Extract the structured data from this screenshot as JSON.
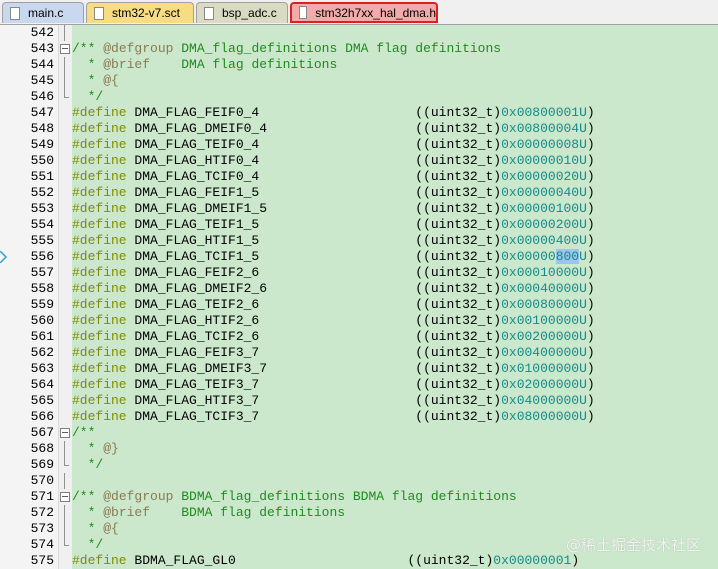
{
  "tabs": [
    {
      "label": "main.c",
      "color": "#c9d7ef",
      "active": false
    },
    {
      "label": "stm32-v7.sct",
      "color": "#f7dc82",
      "active": false
    },
    {
      "label": "bsp_adc.c",
      "color": "#d9dcc2",
      "active": false
    },
    {
      "label": "stm32h7xx_hal_dma.h",
      "color": "#f2aaaa",
      "active": true
    }
  ],
  "editor": {
    "current_line": 556,
    "highlight": {
      "line": 556,
      "text": "800"
    },
    "lines": [
      {
        "num": 542,
        "kind": "blank"
      },
      {
        "num": 543,
        "kind": "doc",
        "fold": true,
        "text": "/** @defgroup DMA_flag_definitions DMA flag definitions"
      },
      {
        "num": 544,
        "kind": "doc",
        "text": "  * @brief    DMA flag definitions"
      },
      {
        "num": 545,
        "kind": "doc",
        "text": "  * @{"
      },
      {
        "num": 546,
        "kind": "doc",
        "text": "  */"
      },
      {
        "num": 547,
        "kind": "define",
        "name": "DMA_FLAG_FEIF0_4",
        "cast": "((uint32_t)",
        "value": "0x00800001U",
        "close": ")"
      },
      {
        "num": 548,
        "kind": "define",
        "name": "DMA_FLAG_DMEIF0_4",
        "cast": "((uint32_t)",
        "value": "0x00800004U",
        "close": ")"
      },
      {
        "num": 549,
        "kind": "define",
        "name": "DMA_FLAG_TEIF0_4",
        "cast": "((uint32_t)",
        "value": "0x00000008U",
        "close": ")"
      },
      {
        "num": 550,
        "kind": "define",
        "name": "DMA_FLAG_HTIF0_4",
        "cast": "((uint32_t)",
        "value": "0x00000010U",
        "close": ")"
      },
      {
        "num": 551,
        "kind": "define",
        "name": "DMA_FLAG_TCIF0_4",
        "cast": "((uint32_t)",
        "value": "0x00000020U",
        "close": ")"
      },
      {
        "num": 552,
        "kind": "define",
        "name": "DMA_FLAG_FEIF1_5",
        "cast": "((uint32_t)",
        "value": "0x00000040U",
        "close": ")"
      },
      {
        "num": 553,
        "kind": "define",
        "name": "DMA_FLAG_DMEIF1_5",
        "cast": "((uint32_t)",
        "value": "0x00000100U",
        "close": ")"
      },
      {
        "num": 554,
        "kind": "define",
        "name": "DMA_FLAG_TEIF1_5",
        "cast": "((uint32_t)",
        "value": "0x00000200U",
        "close": ")"
      },
      {
        "num": 555,
        "kind": "define",
        "name": "DMA_FLAG_HTIF1_5",
        "cast": "((uint32_t)",
        "value": "0x00000400U",
        "close": ")"
      },
      {
        "num": 556,
        "kind": "define",
        "name": "DMA_FLAG_TCIF1_5",
        "cast": "((uint32_t)",
        "value": "0x00000800U",
        "close": ")"
      },
      {
        "num": 557,
        "kind": "define",
        "name": "DMA_FLAG_FEIF2_6",
        "cast": "((uint32_t)",
        "value": "0x00010000U",
        "close": ")"
      },
      {
        "num": 558,
        "kind": "define",
        "name": "DMA_FLAG_DMEIF2_6",
        "cast": "((uint32_t)",
        "value": "0x00040000U",
        "close": ")"
      },
      {
        "num": 559,
        "kind": "define",
        "name": "DMA_FLAG_TEIF2_6",
        "cast": "((uint32_t)",
        "value": "0x00080000U",
        "close": ")"
      },
      {
        "num": 560,
        "kind": "define",
        "name": "DMA_FLAG_HTIF2_6",
        "cast": "((uint32_t)",
        "value": "0x00100000U",
        "close": ")"
      },
      {
        "num": 561,
        "kind": "define",
        "name": "DMA_FLAG_TCIF2_6",
        "cast": "((uint32_t)",
        "value": "0x00200000U",
        "close": ")"
      },
      {
        "num": 562,
        "kind": "define",
        "name": "DMA_FLAG_FEIF3_7",
        "cast": "((uint32_t)",
        "value": "0x00400000U",
        "close": ")"
      },
      {
        "num": 563,
        "kind": "define",
        "name": "DMA_FLAG_DMEIF3_7",
        "cast": "((uint32_t)",
        "value": "0x01000000U",
        "close": ")"
      },
      {
        "num": 564,
        "kind": "define",
        "name": "DMA_FLAG_TEIF3_7",
        "cast": "((uint32_t)",
        "value": "0x02000000U",
        "close": ")"
      },
      {
        "num": 565,
        "kind": "define",
        "name": "DMA_FLAG_HTIF3_7",
        "cast": "((uint32_t)",
        "value": "0x04000000U",
        "close": ")"
      },
      {
        "num": 566,
        "kind": "define",
        "name": "DMA_FLAG_TCIF3_7",
        "cast": "((uint32_t)",
        "value": "0x08000000U",
        "close": ")"
      },
      {
        "num": 567,
        "kind": "doc",
        "fold": true,
        "text": "/**"
      },
      {
        "num": 568,
        "kind": "doc",
        "text": "  * @}"
      },
      {
        "num": 569,
        "kind": "doc",
        "text": "  */"
      },
      {
        "num": 570,
        "kind": "blank"
      },
      {
        "num": 571,
        "kind": "doc",
        "fold": true,
        "text": "/** @defgroup BDMA_flag_definitions BDMA flag definitions"
      },
      {
        "num": 572,
        "kind": "doc",
        "text": "  * @brief    BDMA flag definitions"
      },
      {
        "num": 573,
        "kind": "doc",
        "text": "  * @{"
      },
      {
        "num": 574,
        "kind": "doc",
        "text": "  */"
      },
      {
        "num": 575,
        "kind": "define",
        "name": "BDMA_FLAG_GL0",
        "cast": "((uint32_t)",
        "value": "0x00000001",
        "close": ")"
      }
    ],
    "keyword": "#define"
  },
  "watermark": "@稀土掘金技术社区"
}
